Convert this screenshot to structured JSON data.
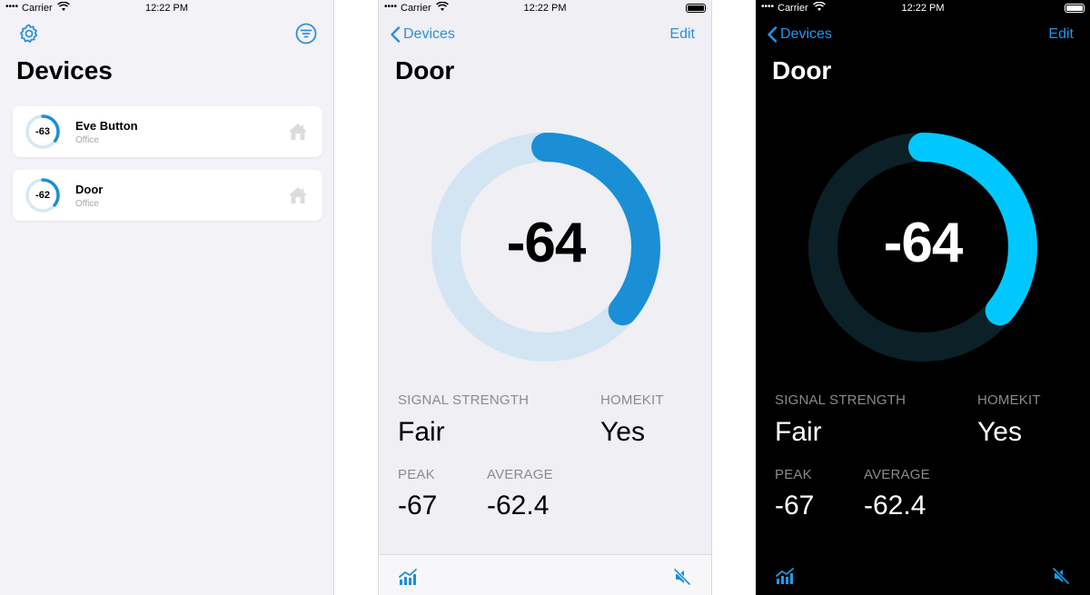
{
  "status_bar": {
    "carrier": "Carrier",
    "time": "12:22 PM"
  },
  "list_screen": {
    "title": "Devices",
    "devices": [
      {
        "name": "Eve Button",
        "room": "Office",
        "rssi": "-63",
        "ring_fraction": 0.35
      },
      {
        "name": "Door",
        "room": "Office",
        "rssi": "-62",
        "ring_fraction": 0.36
      }
    ]
  },
  "detail_screen": {
    "back_label": "Devices",
    "edit_label": "Edit",
    "title": "Door",
    "rssi": "-64",
    "gauge_fraction": 0.36,
    "signal_strength_label": "SIGNAL STRENGTH",
    "signal_strength_value": "Fair",
    "homekit_label": "HOMEKIT",
    "homekit_value": "Yes",
    "peak_label": "PEAK",
    "peak_value": "-67",
    "average_label": "AVERAGE",
    "average_value": "-62.4"
  },
  "colors": {
    "light_accent": "#1a8fd6",
    "light_track": "#d3e4f3",
    "dark_accent": "#00c8ff",
    "dark_track": "#0b2027",
    "link_blue": "#2e8fd4"
  },
  "icons": [
    "gear-icon",
    "filter-icon",
    "home-icon",
    "chevron-left-icon",
    "chart-icon",
    "mute-icon",
    "wifi-icon",
    "battery-icon"
  ]
}
